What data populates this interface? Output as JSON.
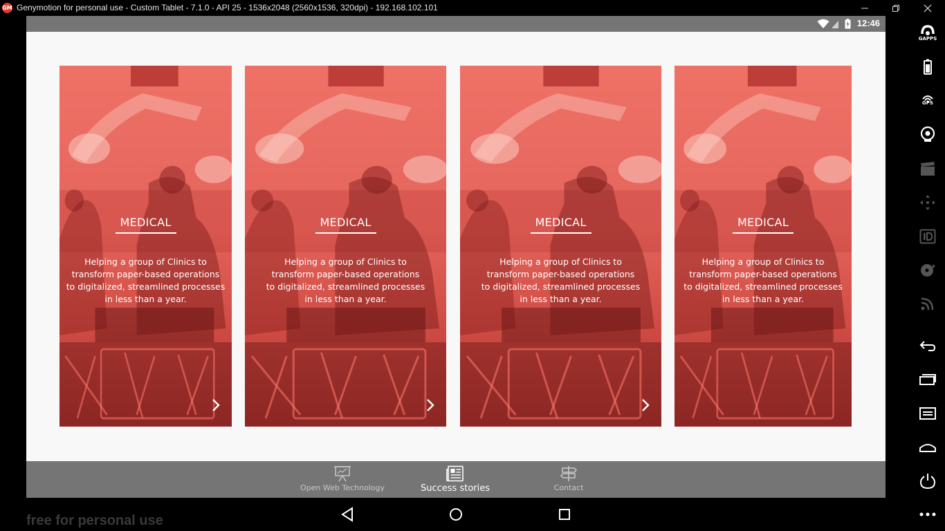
{
  "window": {
    "title": "Genymotion for personal use - Custom Tablet - 7.1.0 - API 25 - 1536x2048 (2560x1536, 320dpi) - 192.168.102.101",
    "logo_text": "GM",
    "controls": [
      "minimize",
      "restore",
      "close"
    ]
  },
  "statusbar": {
    "time": "12:46",
    "icons": [
      "wifi-icon",
      "signal-icon",
      "battery-charging-icon"
    ]
  },
  "cards": [
    {
      "title": "MEDICAL",
      "lines": [
        "Helping a group of Clinics to",
        "transform paper-based operations",
        "to digitalized, streamlined processes",
        "in less than a year."
      ],
      "has_arrow": true
    },
    {
      "title": "MEDICAL",
      "lines": [
        "Helping a group of Clinics to",
        "transform paper-based operations",
        "to digitalized, streamlined processes",
        "in less than a year."
      ],
      "has_arrow": true
    },
    {
      "title": "MEDICAL",
      "lines": [
        "Helping a group of Clinics to",
        "transform paper-based operations",
        "to digitalized, streamlined processes",
        "in less than a year."
      ],
      "has_arrow": true
    },
    {
      "title": "MEDICAL",
      "lines": [
        "Helping a group of Clinics to",
        "transform paper-based operations",
        "to digitalized, streamlined processes",
        "in less than a year."
      ],
      "has_arrow": false
    }
  ],
  "tabs": [
    {
      "label": "Open Web Technology",
      "icon": "presentation-icon",
      "active": false
    },
    {
      "label": "Success stories",
      "icon": "newspaper-icon",
      "active": true
    },
    {
      "label": "Contact",
      "icon": "signpost-icon",
      "active": false
    }
  ],
  "navbar": [
    "back-icon",
    "home-icon",
    "recents-icon"
  ],
  "watermark": "free for personal use",
  "sidebar": {
    "gapps_label": "GAPPS",
    "gps_label": "GPS",
    "items": [
      "gapps-icon",
      "battery-icon",
      "gps-icon",
      "webcam-icon",
      "clapper-icon",
      "dpad-icon",
      "id-icon",
      "disk-icon",
      "cast-icon",
      "back-icon",
      "recents-icon",
      "menu-icon",
      "home-icon",
      "power-icon",
      "more-icon"
    ]
  },
  "colors": {
    "card_overlay": "#e2544a",
    "bar_gray": "#757575",
    "content_bg": "#f8f8f8"
  }
}
